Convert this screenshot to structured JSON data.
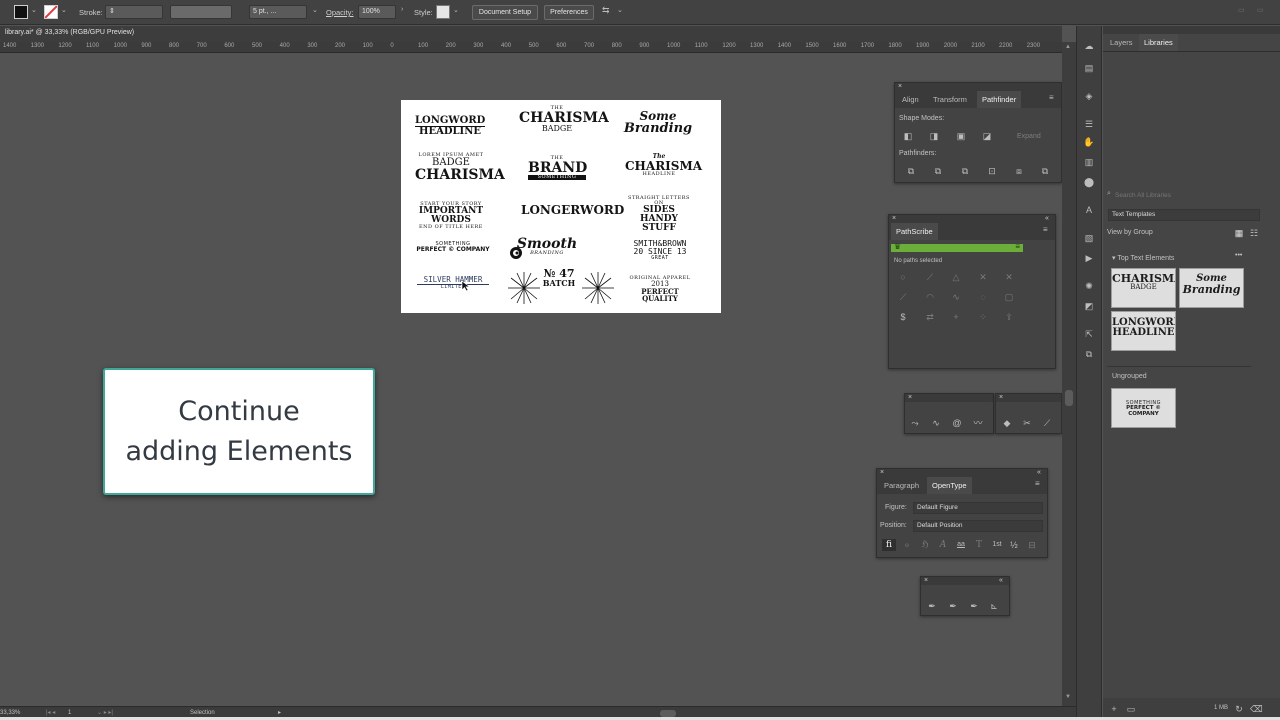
{
  "control_bar": {
    "stroke_label": "Stroke:",
    "brush_value": "5 pt., ...",
    "opacity_label": "Opacity:",
    "opacity_value": "100%",
    "style_label": "Style:",
    "document_setup": "Document Setup",
    "preferences": "Preferences"
  },
  "document": {
    "tab_title": "library.ai* @ 33,33% (RGB/GPU Preview)",
    "ruler_ticks": [
      "1400",
      "1300",
      "1200",
      "1100",
      "1000",
      "900",
      "800",
      "700",
      "600",
      "500",
      "400",
      "300",
      "200",
      "100",
      "0",
      "100",
      "200",
      "300",
      "400",
      "500",
      "600",
      "700",
      "800",
      "900",
      "1000",
      "1100",
      "1200",
      "1300",
      "1400",
      "1500",
      "1600",
      "1700",
      "1800",
      "1900",
      "2000",
      "2100",
      "2200",
      "2300"
    ]
  },
  "artboard_logos": {
    "longword1": "LONGWORD",
    "headline1": "HEADLINE",
    "charisma_the": "THE",
    "charisma1": "CHARISMA",
    "badge1": "BADGE",
    "some": "Some",
    "branding1": "Branding",
    "lorem": "LOREM IPSUM AMET",
    "badge2": "BADGE",
    "charisma2": "CHARISMA",
    "brand_the": "THE",
    "brand": "BRAND",
    "something1": "SOMETHING",
    "the2": "The",
    "charisma3": "CHARISMA",
    "headline2": "HEADLINE",
    "start_story": "START YOUR STORY",
    "important": "IMPORTANT WORDS",
    "title_here": "END OF TITLE HERE",
    "longerword": "LONGERWORD",
    "straight": "STRAIGHT LETTERS ON",
    "sides": "SIDES",
    "handy": "HANDY STUFF",
    "something2": "SOMETHING",
    "perfect_company": "PERFECT © COMPANY",
    "smooth": "Smooth",
    "branding2": "BRANDING",
    "smith": "SMITH&BROWN",
    "since": "20 SINCE 13",
    "spacer": "GREAT",
    "silver": "SILVER HAMMER",
    "limited": "LIMITED",
    "no47": "№ 47",
    "batch": "BATCH",
    "original": "ORIGINAL APPAREL",
    "year": "2013",
    "quality": "PERFECT QUALITY"
  },
  "callout": {
    "line1": "Continue",
    "line2": "adding Elements"
  },
  "pathfinder_panel": {
    "tabs": [
      "Align",
      "Transform",
      "Pathfinder"
    ],
    "shape_modes": "Shape Modes:",
    "expand": "Expand",
    "pathfinders": "Pathfinders:"
  },
  "pathscribe_panel": {
    "title": "PathScribe",
    "status": "No paths selected"
  },
  "opentype_panel": {
    "tabs": [
      "Paragraph",
      "OpenType"
    ],
    "figure_label": "Figure:",
    "figure_value": "Default Figure",
    "position_label": "Position:",
    "position_value": "Default Position",
    "glyphs": [
      "fi",
      "ℴ",
      "ℌ",
      "A",
      "aa",
      "T",
      "1st",
      "½"
    ]
  },
  "libraries": {
    "tabs": [
      "Layers",
      "Libraries"
    ],
    "search_placeholder": "Search All Libraries",
    "library_name": "Text Templates",
    "view_by": "View by Group",
    "group_top": "Top Text Elements",
    "group_ungrouped": "Ungrouped",
    "size": "1 MB"
  },
  "status_bar": {
    "zoom": "33,33%",
    "artboard_num": "1",
    "tool": "Selection"
  },
  "colors": {
    "accent_green": "#6cae3a",
    "callout_border": "#3fa89a"
  }
}
